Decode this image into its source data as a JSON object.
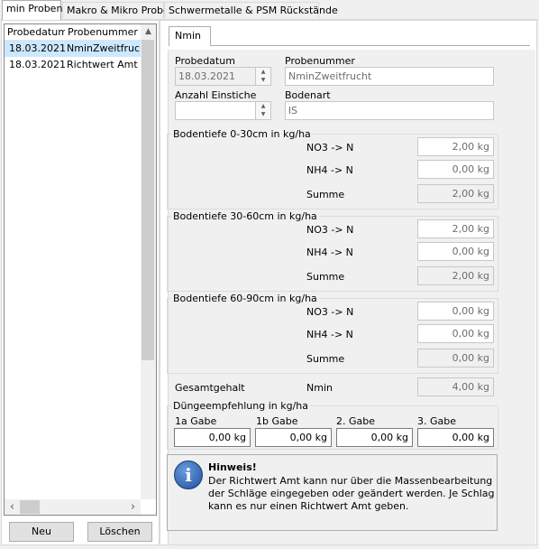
{
  "tabs": [
    {
      "label": "min Proben"
    },
    {
      "label": "Makro & Mikro Proben"
    },
    {
      "label": "Schwermetalle & PSM Rückstände"
    }
  ],
  "list": {
    "columns": [
      "Probedatum",
      "Probenummer"
    ],
    "rows": [
      {
        "date": "18.03.2021",
        "nummer": "NminZweitfrucht",
        "selected": true
      },
      {
        "date": "18.03.2021",
        "nummer": "Richtwert Amt",
        "selected": false
      }
    ]
  },
  "buttons": {
    "neu": "Neu",
    "loeschen": "Löschen"
  },
  "subtab": {
    "label": "Nmin"
  },
  "form": {
    "probedatum_label": "Probedatum",
    "probedatum_value": "18.03.2021",
    "probenummer_label": "Probenummer",
    "probenummer_value": "NminZweitfrucht",
    "einstiche_label": "Anzahl Einstiche",
    "einstiche_value": "",
    "bodenart_label": "Bodenart",
    "bodenart_value": "lS"
  },
  "depths": [
    {
      "title": "Bodentiefe 0-30cm in kg/ha",
      "no3_label": "NO3 -> N",
      "no3": "2,00 kg",
      "nh4_label": "NH4 -> N",
      "nh4": "0,00 kg",
      "summe_label": "Summe",
      "summe": "2,00 kg"
    },
    {
      "title": "Bodentiefe 30-60cm in kg/ha",
      "no3_label": "NO3 -> N",
      "no3": "2,00 kg",
      "nh4_label": "NH4 -> N",
      "nh4": "0,00 kg",
      "summe_label": "Summe",
      "summe": "2,00 kg"
    },
    {
      "title": "Bodentiefe 60-90cm in kg/ha",
      "no3_label": "NO3 -> N",
      "no3": "0,00 kg",
      "nh4_label": "NH4 -> N",
      "nh4": "0,00 kg",
      "summe_label": "Summe",
      "summe": "0,00 kg"
    }
  ],
  "gesamt": {
    "label": "Gesamtgehalt",
    "nmin_label": "Nmin",
    "value": "4,00 kg"
  },
  "duenge": {
    "title": "Düngeempfehlung in kg/ha",
    "gaben": [
      {
        "label": "1a Gabe",
        "value": "0,00 kg"
      },
      {
        "label": "1b Gabe",
        "value": "0,00 kg"
      },
      {
        "label": "2. Gabe",
        "value": "0,00 kg"
      },
      {
        "label": "3. Gabe",
        "value": "0,00 kg"
      }
    ]
  },
  "hinweis": {
    "title": "Hinweis!",
    "line1": "Der Richtwert Amt kann nur über die Massenbearbeitung",
    "line2": "der Schläge eingegeben oder geändert werden. Je Schlag",
    "line3": "kann es nur einen Richtwert Amt geben.",
    "icon": "info-icon"
  },
  "colors": {
    "selection": "#cce8ff",
    "info_icon": "#1f4f9c"
  }
}
